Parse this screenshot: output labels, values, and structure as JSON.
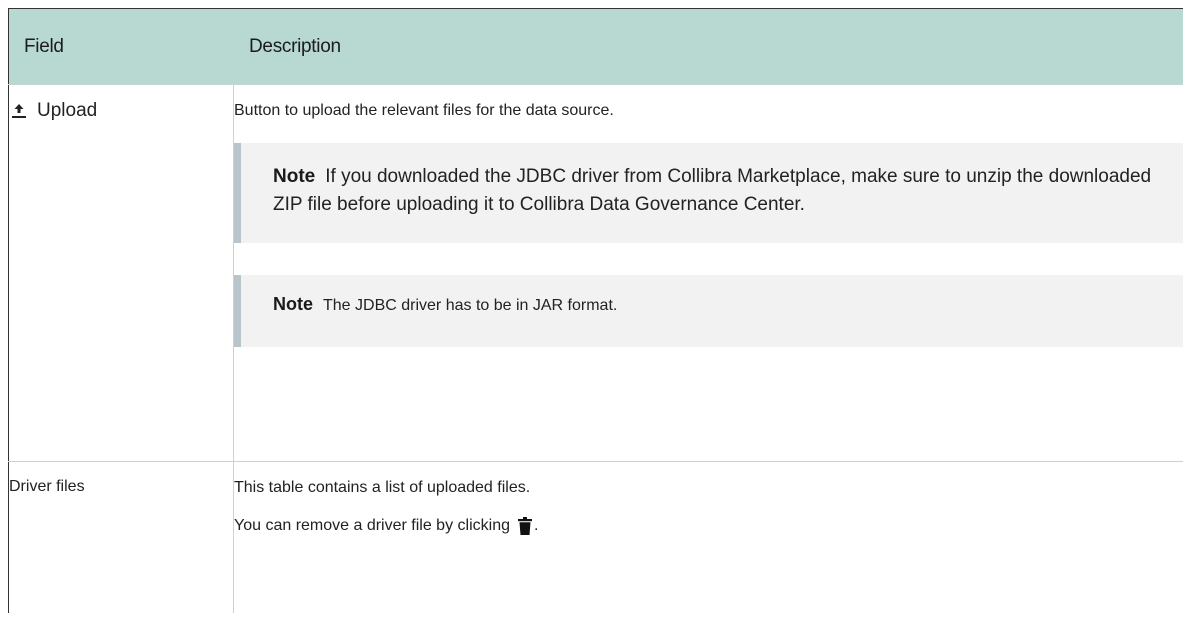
{
  "table": {
    "headers": {
      "field": "Field",
      "description": "Description"
    },
    "rows": {
      "upload": {
        "field_label": "Upload",
        "field_icon": "upload-icon",
        "description": "Button to upload the relevant files for the data source.",
        "note1": {
          "label": "Note",
          "text": "If you downloaded the JDBC driver from Collibra Marketplace, make sure to unzip the downloaded ZIP file before uploading it to Collibra Data Governance Center."
        },
        "note2": {
          "label": "Note",
          "text": "The JDBC driver has to be in JAR format."
        }
      },
      "driver_files": {
        "field_label": "Driver files",
        "description_line1": "This table contains a list of uploaded files.",
        "description_line2": "You can remove a driver file by clicking",
        "description_line2_end": ".",
        "remove_icon": "trash-icon"
      }
    }
  },
  "colors": {
    "header_bg": "#b7d9d2",
    "note_bg": "#f2f2f2",
    "note_border": "#b9c4cb"
  }
}
